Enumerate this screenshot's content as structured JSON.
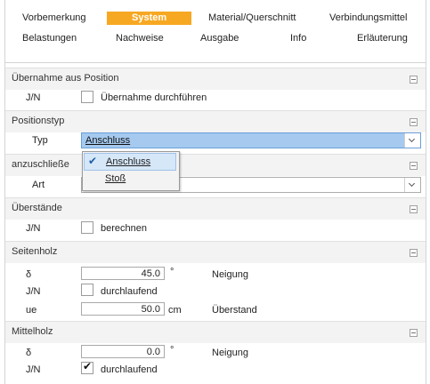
{
  "tabs_row1": [
    "Vorbemerkung",
    "System",
    "Material/Querschnitt",
    "Verbindungsmittel"
  ],
  "tabs_row2": [
    "Belastungen",
    "Nachweise",
    "Ausgabe",
    "Info",
    "Erläuterung"
  ],
  "active_tab": "System",
  "accent_color": "#f7a823",
  "sections": {
    "uebernahme": {
      "title": "Übernahme aus Position",
      "row_label": "J/N",
      "checkbox_label": "Übernahme durchführen",
      "checked": false
    },
    "positionstyp": {
      "title": "Positionstyp",
      "row_label": "Typ",
      "selected": "Anschluss"
    },
    "anzuschliessen": {
      "title": "anzuschließe",
      "row_label": "Art",
      "selected": ""
    },
    "ueberstaende": {
      "title": "Überstände",
      "row_label": "J/N",
      "checkbox_label": "berechnen",
      "checked": false
    },
    "seitenholz": {
      "title": "Seitenholz",
      "delta_label": "δ",
      "delta_value": "45.0",
      "delta_unit": "°",
      "delta_desc": "Neigung",
      "jn_label": "J/N",
      "checkbox_label": "durchlaufend",
      "checked": false,
      "ue_label": "ue",
      "ue_value": "50.0",
      "ue_unit": "cm",
      "ue_desc": "Überstand"
    },
    "mittelholz": {
      "title": "Mittelholz",
      "delta_label": "δ",
      "delta_value": "0.0",
      "delta_unit": "°",
      "delta_desc": "Neigung",
      "jn_label": "J/N",
      "checkbox_label": "durchlaufend",
      "checked": true
    }
  },
  "dropdown": {
    "options": [
      "Anschluss",
      "Stoß"
    ],
    "selected": "Anschluss",
    "check_glyph": "✔"
  },
  "check_glyph": "✔"
}
